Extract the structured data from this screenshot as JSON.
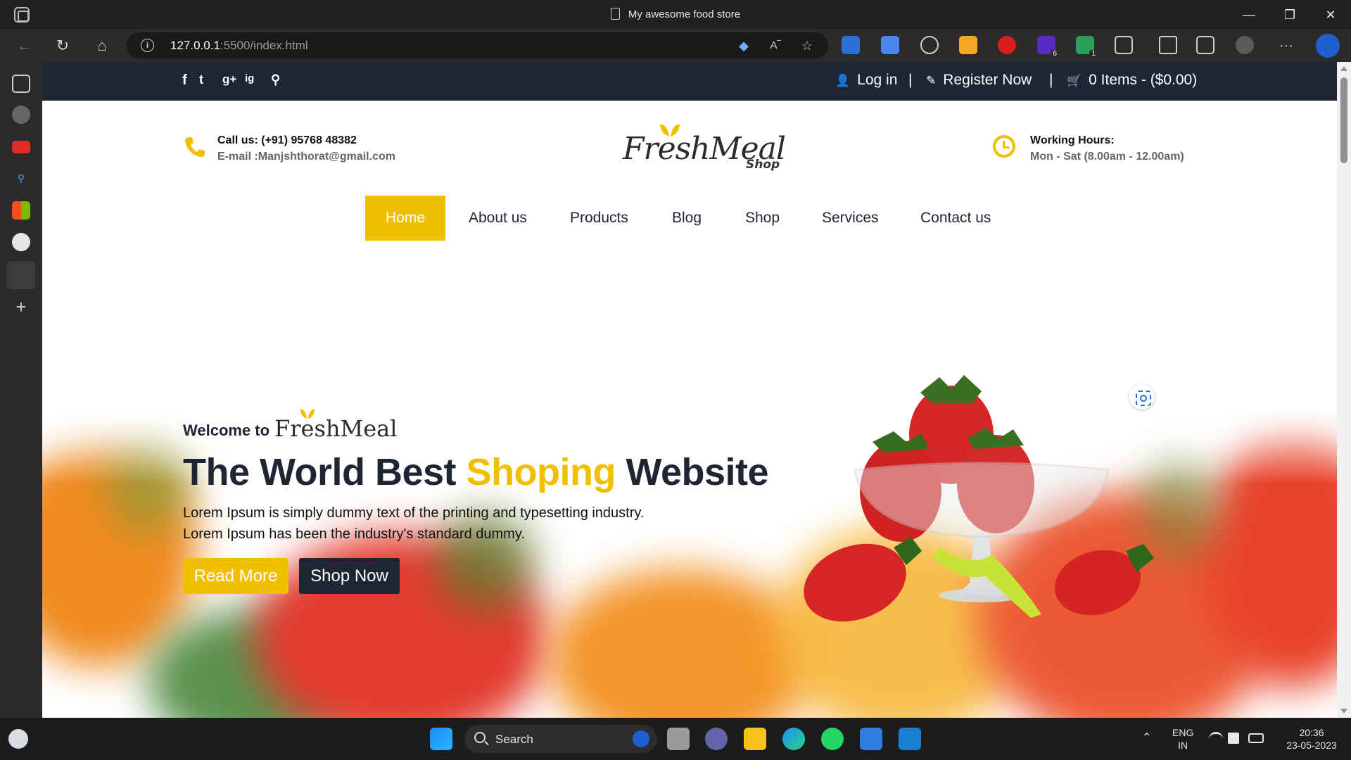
{
  "browser": {
    "tab_title": "My awesome food store",
    "url_host": "127.0.0.1",
    "url_rest": ":5500/index.html",
    "window_controls": {
      "minimize": "—",
      "restore": "❐",
      "close": "✕"
    },
    "extension_badges": {
      "ext_6": "6",
      "ext_7": "1"
    },
    "more_label": "···"
  },
  "topbar": {
    "social_icons": [
      "f",
      "t",
      "g+",
      "ig",
      "search"
    ],
    "login": "Log in",
    "separator": "|",
    "register": "Register Now",
    "cart": "0 Items - ($0.00)"
  },
  "header": {
    "call": "Call us: (+91) 95768 48382",
    "email": "E-mail :Manjshthorat@gmail.com",
    "logo_script": "FreshMeal",
    "logo_sub": "Shop",
    "hours_title": "Working Hours:",
    "hours_text": "Mon - Sat (8.00am - 12.00am)"
  },
  "nav": {
    "items": [
      "Home",
      "About us",
      "Products",
      "Blog",
      "Shop",
      "Services",
      "Contact us"
    ],
    "active": "Home"
  },
  "hero": {
    "welcome": "Welcome to",
    "brand": "FreshMeal",
    "headline_start": "The World Best ",
    "headline_accent": "Shoping",
    "headline_end": " Website",
    "line1": "Lorem Ipsum is simply dummy text of the printing and typesetting industry.",
    "line2": "Lorem Ipsum has been the industry's standard dummy.",
    "read_more": "Read More",
    "shop_now": "Shop Now"
  },
  "taskbar": {
    "search": "Search",
    "lang_top": "ENG",
    "lang_bottom": "IN",
    "time": "20:36",
    "date": "23-05-2023",
    "chevron": "⌃"
  },
  "colors": {
    "accent": "#efbf00",
    "dark": "#1e2534",
    "chrome": "#202020"
  }
}
